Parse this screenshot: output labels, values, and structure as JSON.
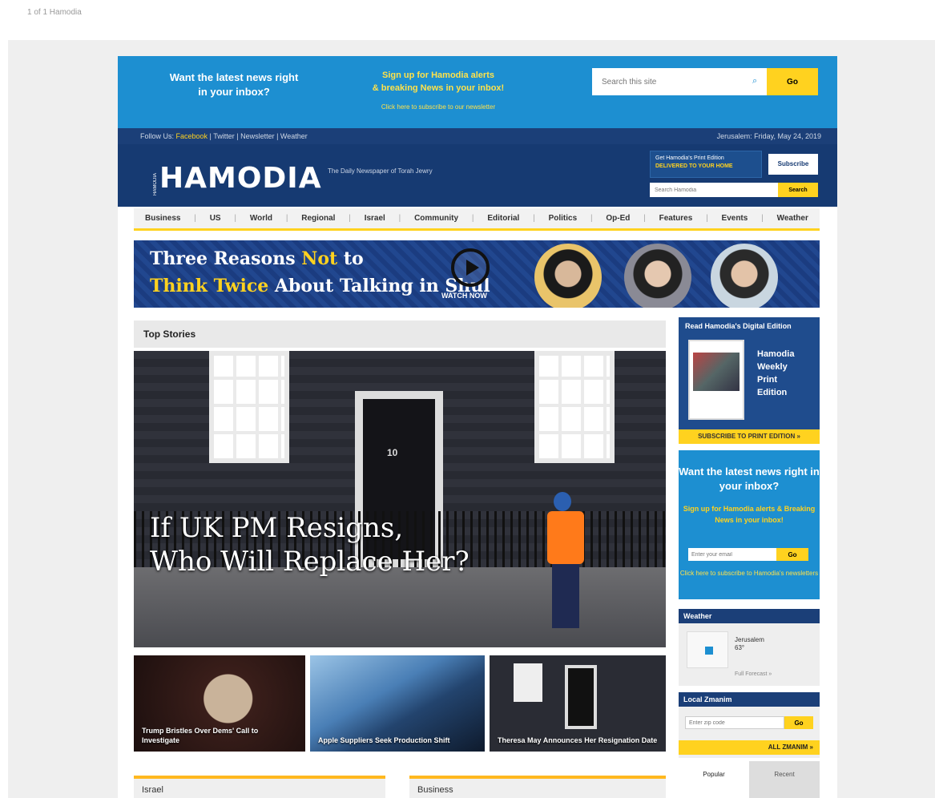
{
  "breadcrumb": "1 of 1 Hamodia",
  "promo": {
    "left_text": "Want the latest news right in your inbox?",
    "middle_line1": "Sign up for Hamodia alerts",
    "middle_line2": "& breaking News in your inbox!",
    "middle_fine": "Click here to subscribe to our newsletter",
    "search_placeholder": "Search this site",
    "search_button": "Go"
  },
  "topbar": {
    "left_prefix": "Follow Us: ",
    "left_highlight": "Facebook",
    "left_suffix": " | Twitter | Newsletter | Weather",
    "right": "Jerusalem: Friday, May 24, 2019"
  },
  "masthead": {
    "logo_prefix": "HAMODIA",
    "logo": "HAMODIA",
    "tagline": "The Daily Newspaper of Torah Jewry",
    "ad_line1": "Get Hamodia's Print Edition",
    "ad_line2": "DELIVERED TO YOUR HOME",
    "sub_label": "Subscribe",
    "search_placeholder": "Search Hamodia",
    "search_button": "Search"
  },
  "nav": {
    "items": [
      "Business",
      "US",
      "World",
      "Regional",
      "Israel",
      "Community",
      "Editorial",
      "Politics",
      "Op-Ed",
      "Features",
      "Events",
      "Weather"
    ]
  },
  "banner": {
    "line1_white": "Three Reasons ",
    "line1_yellow": "Not",
    "line1_rest": " to",
    "line2_yellow": "Think Twice",
    "line2_white": " About Talking in Shul",
    "watch": "WATCH NOW"
  },
  "top_stories": {
    "header": "Top Stories",
    "headline_line1": "If UK PM Resigns,",
    "headline_line2": "Who Will Replace Her?",
    "thumb1": "Trump Bristles Over Dems' Call to Investigate",
    "thumb2": "Apple Suppliers Seek Production Shift",
    "thumb3": "Theresa May Announces Her Resignation Date"
  },
  "sections": {
    "left": "Israel",
    "right": "Business"
  },
  "sidebar": {
    "print_header": "Read Hamodia's Digital Edition",
    "print_text_1": "Hamodia",
    "print_text_2": "Weekly",
    "print_text_3": "Print",
    "print_text_4": "Edition",
    "print_bar": "SUBSCRIBE TO PRINT EDITION »",
    "signup_title": "Want the latest news right in your inbox?",
    "signup_yellow": "Sign up for Hamodia alerts & Breaking News in your inbox!",
    "signup_placeholder": "Enter your email",
    "signup_button": "Go",
    "signup_fine": "Click here to subscribe to Hamodia's newsletters",
    "weather_header": "Weather",
    "weather_city": "Jerusalem",
    "weather_temp": "63°",
    "weather_more": "Full Forecast »",
    "zmanim_header": "Local Zmanim",
    "zmanim_placeholder": "Enter zip code",
    "zmanim_button": "Go",
    "zmanim_bar": "ALL ZMANIM »",
    "tab1": "Popular",
    "tab2": "Recent"
  }
}
